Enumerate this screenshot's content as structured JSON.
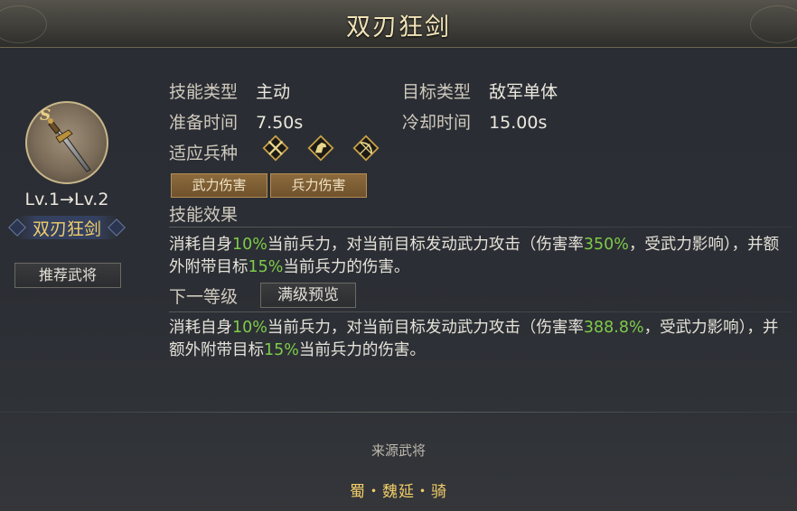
{
  "title": "双刃狂剑",
  "skill_icon": {
    "name": "twin-blade-sword-icon",
    "tier": "S"
  },
  "level_text": "Lv.1→Lv.2",
  "skill_name": "双刃狂剑",
  "recommend_button": "推荐武将",
  "info": {
    "skill_type_label": "技能类型",
    "skill_type_value": "主动",
    "target_type_label": "目标类型",
    "target_type_value": "敌军单体",
    "prep_time_label": "准备时间",
    "prep_time_value": "7.50s",
    "cooldown_label": "冷却时间",
    "cooldown_value": "15.00s",
    "troop_label": "适应兵种",
    "troop_icons": [
      "crossed-spears-icon",
      "horse-cavalry-icon",
      "bow-archer-icon"
    ]
  },
  "tags": [
    "武力伤害",
    "兵力伤害"
  ],
  "effect_title": "技能效果",
  "effect": {
    "p1": "消耗自身",
    "v1": "10%",
    "p2": "当前兵力，对当前目标发动武力攻击（伤害率",
    "v2": "350%",
    "p3": "，受武力影响），并额外附带目标",
    "v3": "15%",
    "p4": "当前兵力的伤害。"
  },
  "next_level_title": "下一等级",
  "max_preview_button": "满级预览",
  "next_effect": {
    "p1": "消耗自身",
    "v1": "10%",
    "p2": "当前兵力，对当前目标发动武力攻击（伤害率",
    "v2": "388.8%",
    "p3": "，受武力影响），并额外附带目标",
    "v3": "15%",
    "p4": "当前兵力的伤害。"
  },
  "source_title": "来源武将",
  "source_general": "蜀・魏延・骑",
  "colors": {
    "highlight_green": "#7fcb4a",
    "gold_text": "#f2ce68",
    "tag_bg": "#7c5d33"
  }
}
